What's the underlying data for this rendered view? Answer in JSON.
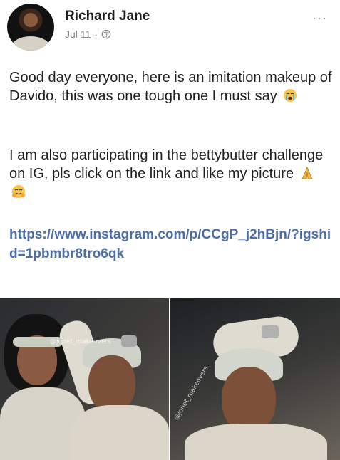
{
  "post": {
    "author": "Richard Jane",
    "date": "Jul 11",
    "separator": "·",
    "more": "···",
    "paragraphs": [
      {
        "text": "Good day everyone, here is an imitation makeup of Davido, this was one tough one I must say",
        "emoji": "crying-face-emoji"
      },
      {
        "text": "I am also participating in the bettybutter challenge on IG, pls click on the link and like my picture",
        "emoji": "folded-hands-emoji"
      }
    ],
    "link": "https://www.instagram.com/p/CCgP_j2hBjn/?igshid=1pbmbr8tro6qk",
    "photos": {
      "watermark_1": "@jonet_makeovers",
      "watermark_2": "@jonet_makeovers"
    }
  },
  "colors": {
    "link": "#4b6ea9",
    "meta": "#7f8387",
    "text": "#1c1e21"
  }
}
